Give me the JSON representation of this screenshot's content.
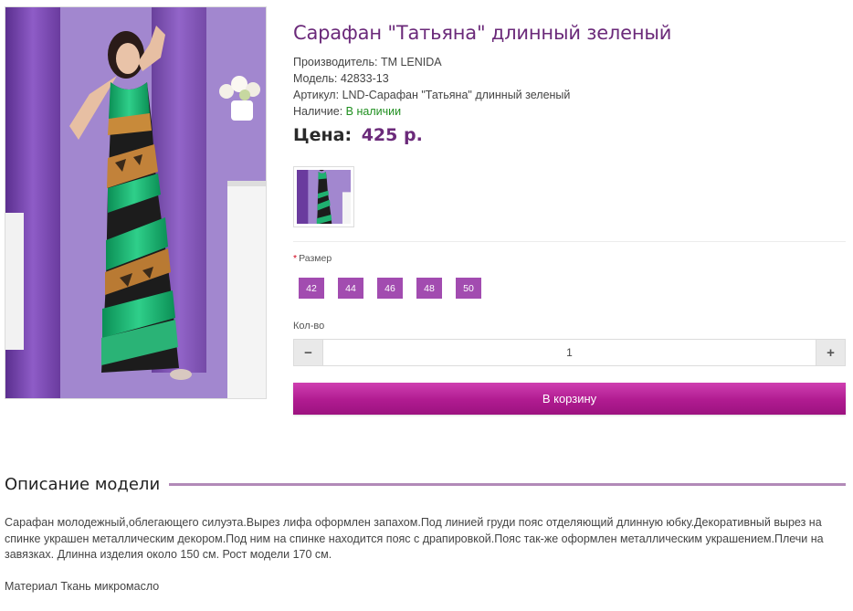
{
  "product": {
    "title": "Сарафан \"Татьяна\" длинный зеленый",
    "manufacturer_label": "Производитель:",
    "manufacturer": "TM LENIDA",
    "model_label": "Модель:",
    "model": "42833-13",
    "sku_label": "Артикул:",
    "sku": "LND-Сарафан \"Татьяна\" длинный зеленый",
    "availability_label": "Наличие:",
    "availability": "В наличии",
    "price_label": "Цена:",
    "price": "425 р."
  },
  "options": {
    "required_mark": "*",
    "size_label": "Размер",
    "sizes": [
      "42",
      "44",
      "46",
      "48",
      "50"
    ]
  },
  "quantity": {
    "label": "Кол-во",
    "value": "1",
    "minus": "−",
    "plus": "+"
  },
  "cart": {
    "button_label": "В корзину"
  },
  "description": {
    "heading": "Описание модели",
    "paragraph1": "Сарафан молодежный,облегающего силуэта.Вырез лифа оформлен запахом.Под линией груди пояс отделяющий длинную юбку.Декоративный вырез на спинке украшен металлическим декором.Под ним на спинке находится пояс с драпировкой.Пояс так-же оформлен металлическим украшением.Плечи на завязках. Длинна изделия около 150 см. Рост модели 170 см.",
    "paragraph2": "Материал Ткань микромасло"
  },
  "colors": {
    "accent": "#6b2a7a",
    "size_button": "#a24cb0",
    "cart_button": "#b01b90",
    "in_stock": "#1f8f1f",
    "heading_rule": "#b28ab8"
  }
}
